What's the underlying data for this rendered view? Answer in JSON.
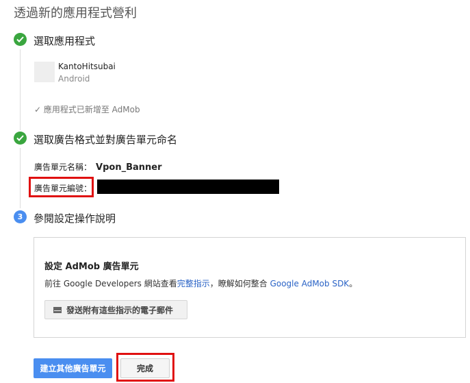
{
  "page": {
    "title": "透過新的應用程式營利"
  },
  "steps": [
    {
      "status": "done",
      "label": "選取應用程式"
    },
    {
      "status": "done",
      "label": "選取廣告格式並對廣告單元命名"
    },
    {
      "status": "current",
      "number": "3",
      "label": "參閱設定操作說明"
    }
  ],
  "app": {
    "name": "KantoHitsubai",
    "platform": "Android",
    "added_note": "✓ 應用程式已新增至 AdMob"
  },
  "ad_unit": {
    "name_label": "廣告單元名稱：",
    "name_value": "Vpon_Banner",
    "id_label": "廣告單元編號："
  },
  "card": {
    "title": "設定 AdMob 廣告單元",
    "desc_prefix": "前往 Google Developers 網站查看",
    "desc_link1": "完整指示",
    "desc_mid": "，瞭解如何整合 ",
    "desc_link2": "Google AdMob SDK",
    "desc_suffix": "。",
    "email_button": "發送附有這些指示的電子郵件"
  },
  "buttons": {
    "create_other": "建立其他廣告單元",
    "done": "完成"
  },
  "colors": {
    "accent_blue": "#4a8ef0",
    "success_green": "#3aa63f",
    "highlight_red": "#e01010",
    "link": "#2a63c6"
  }
}
